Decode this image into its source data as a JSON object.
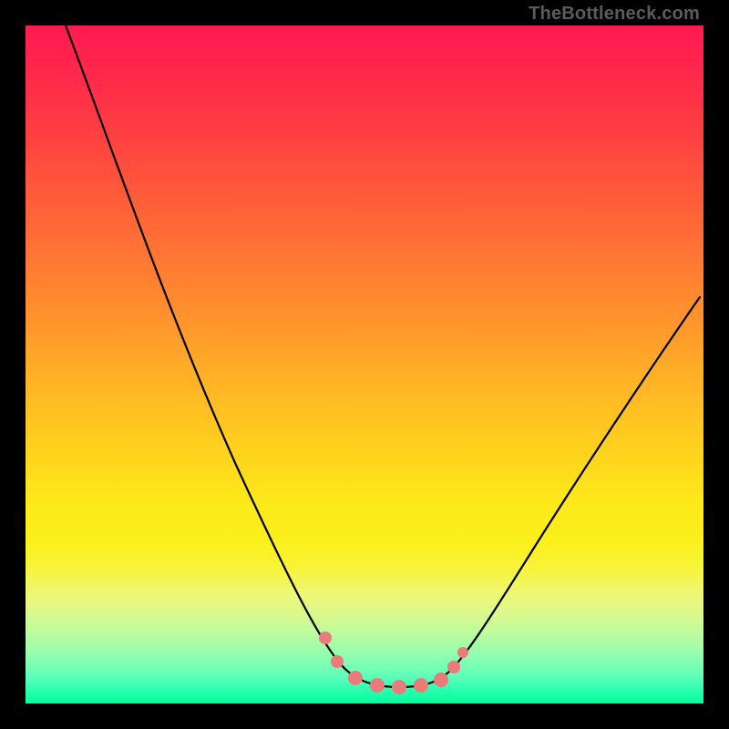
{
  "watermark": "TheBottleneck.com",
  "colors": {
    "gradient_top": "#ff1a52",
    "gradient_mid": "#ffd01e",
    "gradient_bottom": "#00ff9a",
    "curve": "#000000",
    "markers": "#eb7a7a",
    "frame": "#000000"
  },
  "chart_data": {
    "type": "line",
    "title": "",
    "xlabel": "",
    "ylabel": "",
    "xlim": [
      0,
      100
    ],
    "ylim": [
      0,
      100
    ],
    "grid": false,
    "note": "Chart has no visible tick labels or axis text; values below are approximate readings of the curve in percent of plot width (x) and percent of plot height from top (y). y=100 is the bottom edge.",
    "series": [
      {
        "name": "curve",
        "x": [
          6,
          10,
          15,
          20,
          25,
          30,
          35,
          40,
          44,
          46,
          48,
          52,
          56,
          60,
          63,
          65,
          70,
          75,
          80,
          85,
          90,
          95,
          99
        ],
        "y": [
          0,
          12,
          26,
          40,
          52,
          64,
          74,
          82,
          88,
          92,
          95,
          97,
          97,
          97,
          96,
          93,
          86,
          78,
          70,
          62,
          54,
          46,
          40
        ]
      }
    ],
    "markers": {
      "name": "highlighted-points",
      "x": [
        44,
        46,
        49,
        52,
        55,
        58,
        61,
        63,
        64.5
      ],
      "y": [
        90,
        94,
        96.5,
        97.5,
        97.5,
        97.5,
        97,
        95,
        92
      ],
      "radius_px": [
        7,
        7,
        8,
        8,
        8,
        8,
        8,
        7,
        6
      ]
    }
  }
}
